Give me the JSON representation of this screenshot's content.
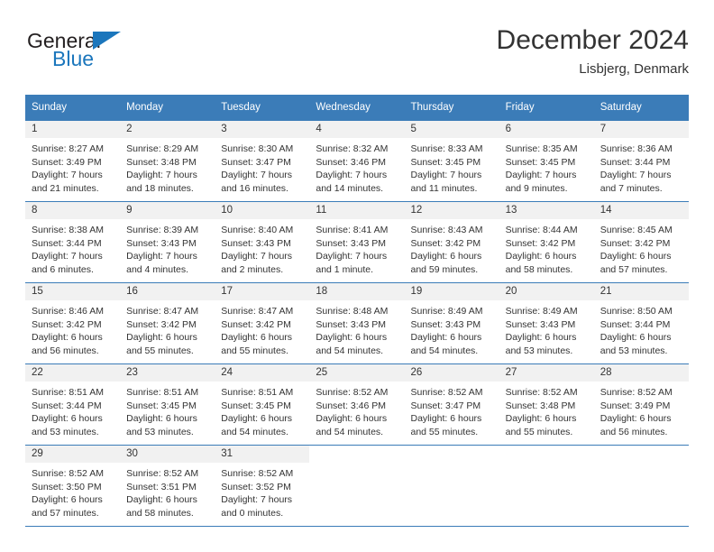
{
  "logo": {
    "word_top": "General",
    "word_bottom": "Blue",
    "triangle_color": "#1b76bc"
  },
  "header": {
    "title": "December 2024",
    "subtitle": "Lisbjerg, Denmark"
  },
  "theme": {
    "header_blue": "#3b7cb8",
    "daynum_gray": "#f1f1f1",
    "text": "#333333"
  },
  "weekday_headers": [
    "Sunday",
    "Monday",
    "Tuesday",
    "Wednesday",
    "Thursday",
    "Friday",
    "Saturday"
  ],
  "labels": {
    "sunrise_prefix": "Sunrise:",
    "sunset_prefix": "Sunset:",
    "daylight_prefix": "Daylight:"
  },
  "weeks": [
    [
      {
        "day": "1",
        "sunrise": "Sunrise: 8:27 AM",
        "sunset": "Sunset: 3:49 PM",
        "daylight1": "Daylight: 7 hours",
        "daylight2": "and 21 minutes."
      },
      {
        "day": "2",
        "sunrise": "Sunrise: 8:29 AM",
        "sunset": "Sunset: 3:48 PM",
        "daylight1": "Daylight: 7 hours",
        "daylight2": "and 18 minutes."
      },
      {
        "day": "3",
        "sunrise": "Sunrise: 8:30 AM",
        "sunset": "Sunset: 3:47 PM",
        "daylight1": "Daylight: 7 hours",
        "daylight2": "and 16 minutes."
      },
      {
        "day": "4",
        "sunrise": "Sunrise: 8:32 AM",
        "sunset": "Sunset: 3:46 PM",
        "daylight1": "Daylight: 7 hours",
        "daylight2": "and 14 minutes."
      },
      {
        "day": "5",
        "sunrise": "Sunrise: 8:33 AM",
        "sunset": "Sunset: 3:45 PM",
        "daylight1": "Daylight: 7 hours",
        "daylight2": "and 11 minutes."
      },
      {
        "day": "6",
        "sunrise": "Sunrise: 8:35 AM",
        "sunset": "Sunset: 3:45 PM",
        "daylight1": "Daylight: 7 hours",
        "daylight2": "and 9 minutes."
      },
      {
        "day": "7",
        "sunrise": "Sunrise: 8:36 AM",
        "sunset": "Sunset: 3:44 PM",
        "daylight1": "Daylight: 7 hours",
        "daylight2": "and 7 minutes."
      }
    ],
    [
      {
        "day": "8",
        "sunrise": "Sunrise: 8:38 AM",
        "sunset": "Sunset: 3:44 PM",
        "daylight1": "Daylight: 7 hours",
        "daylight2": "and 6 minutes."
      },
      {
        "day": "9",
        "sunrise": "Sunrise: 8:39 AM",
        "sunset": "Sunset: 3:43 PM",
        "daylight1": "Daylight: 7 hours",
        "daylight2": "and 4 minutes."
      },
      {
        "day": "10",
        "sunrise": "Sunrise: 8:40 AM",
        "sunset": "Sunset: 3:43 PM",
        "daylight1": "Daylight: 7 hours",
        "daylight2": "and 2 minutes."
      },
      {
        "day": "11",
        "sunrise": "Sunrise: 8:41 AM",
        "sunset": "Sunset: 3:43 PM",
        "daylight1": "Daylight: 7 hours",
        "daylight2": "and 1 minute."
      },
      {
        "day": "12",
        "sunrise": "Sunrise: 8:43 AM",
        "sunset": "Sunset: 3:42 PM",
        "daylight1": "Daylight: 6 hours",
        "daylight2": "and 59 minutes."
      },
      {
        "day": "13",
        "sunrise": "Sunrise: 8:44 AM",
        "sunset": "Sunset: 3:42 PM",
        "daylight1": "Daylight: 6 hours",
        "daylight2": "and 58 minutes."
      },
      {
        "day": "14",
        "sunrise": "Sunrise: 8:45 AM",
        "sunset": "Sunset: 3:42 PM",
        "daylight1": "Daylight: 6 hours",
        "daylight2": "and 57 minutes."
      }
    ],
    [
      {
        "day": "15",
        "sunrise": "Sunrise: 8:46 AM",
        "sunset": "Sunset: 3:42 PM",
        "daylight1": "Daylight: 6 hours",
        "daylight2": "and 56 minutes."
      },
      {
        "day": "16",
        "sunrise": "Sunrise: 8:47 AM",
        "sunset": "Sunset: 3:42 PM",
        "daylight1": "Daylight: 6 hours",
        "daylight2": "and 55 minutes."
      },
      {
        "day": "17",
        "sunrise": "Sunrise: 8:47 AM",
        "sunset": "Sunset: 3:42 PM",
        "daylight1": "Daylight: 6 hours",
        "daylight2": "and 55 minutes."
      },
      {
        "day": "18",
        "sunrise": "Sunrise: 8:48 AM",
        "sunset": "Sunset: 3:43 PM",
        "daylight1": "Daylight: 6 hours",
        "daylight2": "and 54 minutes."
      },
      {
        "day": "19",
        "sunrise": "Sunrise: 8:49 AM",
        "sunset": "Sunset: 3:43 PM",
        "daylight1": "Daylight: 6 hours",
        "daylight2": "and 54 minutes."
      },
      {
        "day": "20",
        "sunrise": "Sunrise: 8:49 AM",
        "sunset": "Sunset: 3:43 PM",
        "daylight1": "Daylight: 6 hours",
        "daylight2": "and 53 minutes."
      },
      {
        "day": "21",
        "sunrise": "Sunrise: 8:50 AM",
        "sunset": "Sunset: 3:44 PM",
        "daylight1": "Daylight: 6 hours",
        "daylight2": "and 53 minutes."
      }
    ],
    [
      {
        "day": "22",
        "sunrise": "Sunrise: 8:51 AM",
        "sunset": "Sunset: 3:44 PM",
        "daylight1": "Daylight: 6 hours",
        "daylight2": "and 53 minutes."
      },
      {
        "day": "23",
        "sunrise": "Sunrise: 8:51 AM",
        "sunset": "Sunset: 3:45 PM",
        "daylight1": "Daylight: 6 hours",
        "daylight2": "and 53 minutes."
      },
      {
        "day": "24",
        "sunrise": "Sunrise: 8:51 AM",
        "sunset": "Sunset: 3:45 PM",
        "daylight1": "Daylight: 6 hours",
        "daylight2": "and 54 minutes."
      },
      {
        "day": "25",
        "sunrise": "Sunrise: 8:52 AM",
        "sunset": "Sunset: 3:46 PM",
        "daylight1": "Daylight: 6 hours",
        "daylight2": "and 54 minutes."
      },
      {
        "day": "26",
        "sunrise": "Sunrise: 8:52 AM",
        "sunset": "Sunset: 3:47 PM",
        "daylight1": "Daylight: 6 hours",
        "daylight2": "and 55 minutes."
      },
      {
        "day": "27",
        "sunrise": "Sunrise: 8:52 AM",
        "sunset": "Sunset: 3:48 PM",
        "daylight1": "Daylight: 6 hours",
        "daylight2": "and 55 minutes."
      },
      {
        "day": "28",
        "sunrise": "Sunrise: 8:52 AM",
        "sunset": "Sunset: 3:49 PM",
        "daylight1": "Daylight: 6 hours",
        "daylight2": "and 56 minutes."
      }
    ],
    [
      {
        "day": "29",
        "sunrise": "Sunrise: 8:52 AM",
        "sunset": "Sunset: 3:50 PM",
        "daylight1": "Daylight: 6 hours",
        "daylight2": "and 57 minutes."
      },
      {
        "day": "30",
        "sunrise": "Sunrise: 8:52 AM",
        "sunset": "Sunset: 3:51 PM",
        "daylight1": "Daylight: 6 hours",
        "daylight2": "and 58 minutes."
      },
      {
        "day": "31",
        "sunrise": "Sunrise: 8:52 AM",
        "sunset": "Sunset: 3:52 PM",
        "daylight1": "Daylight: 7 hours",
        "daylight2": "and 0 minutes."
      },
      {
        "day": "",
        "sunrise": "",
        "sunset": "",
        "daylight1": "",
        "daylight2": ""
      },
      {
        "day": "",
        "sunrise": "",
        "sunset": "",
        "daylight1": "",
        "daylight2": ""
      },
      {
        "day": "",
        "sunrise": "",
        "sunset": "",
        "daylight1": "",
        "daylight2": ""
      },
      {
        "day": "",
        "sunrise": "",
        "sunset": "",
        "daylight1": "",
        "daylight2": ""
      }
    ]
  ]
}
